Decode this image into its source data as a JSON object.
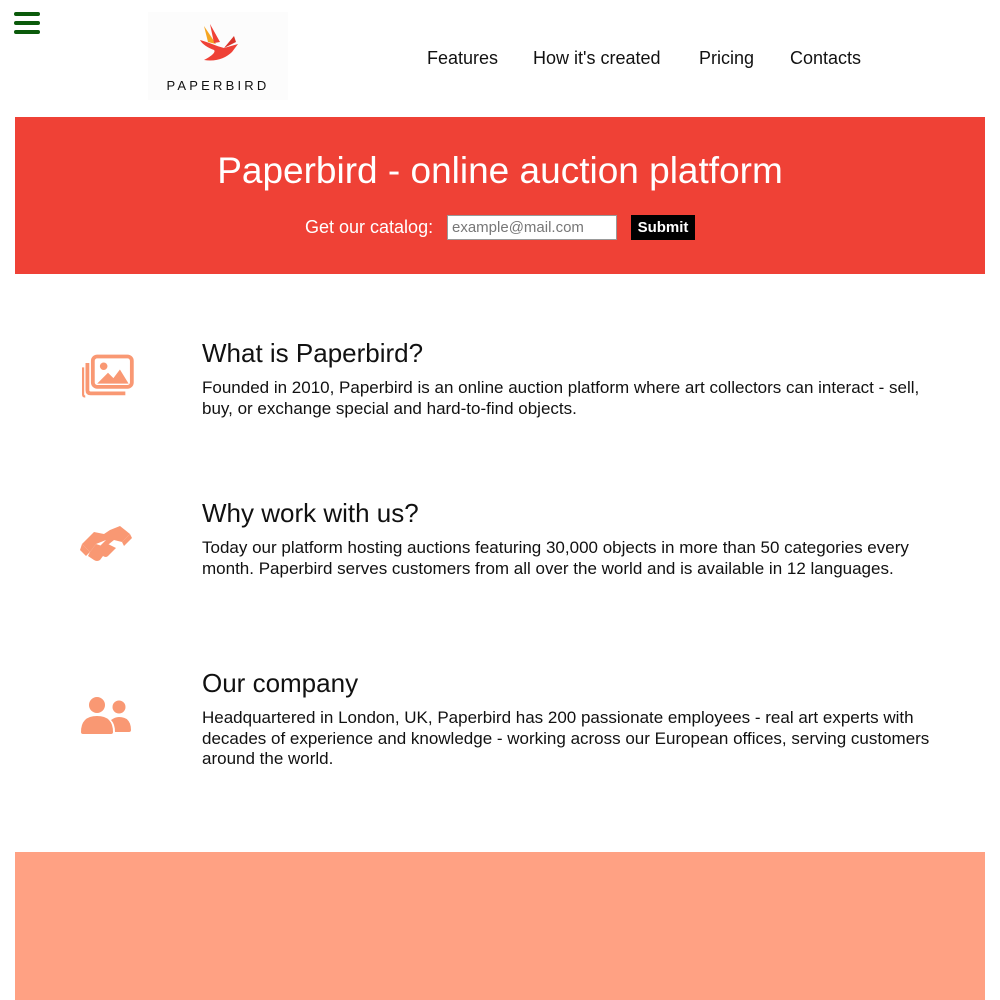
{
  "colors": {
    "accent_red": "#ef4136",
    "accent_salmon": "#ffa183",
    "icon_salmon": "#f99873",
    "menu_green": "#0b5a0b",
    "logo_orange": "#f5a623"
  },
  "header": {
    "menu_icon": "hamburger-menu-icon",
    "logo": {
      "text": "PAPERBIRD",
      "icon": "paperbird-logo-icon"
    },
    "nav": [
      {
        "label": "Features"
      },
      {
        "label": "How it's created"
      },
      {
        "label": "Pricing"
      },
      {
        "label": "Contacts"
      }
    ]
  },
  "hero": {
    "title": "Paperbird - online auction platform",
    "catalog_label": "Get our catalog:",
    "email_placeholder": "example@mail.com",
    "email_value": "",
    "submit_label": "Submit"
  },
  "features": [
    {
      "icon": "image-gallery-icon",
      "title": "What is Paperbird?",
      "text": "Founded in 2010, Paperbird is an online auction platform where art collectors can interact - sell, buy, or exchange special and hard-to-find objects."
    },
    {
      "icon": "handshake-icon",
      "title": "Why work with us?",
      "text": "Today our platform hosting auctions featuring 30,000 objects in more than 50 categories every month. Paperbird serves customers from all over the world and is available in 12 languages."
    },
    {
      "icon": "users-icon",
      "title": "Our company",
      "text": "Headquartered in London, UK, Paperbird has 200 passionate employees - real art experts with decades of experience and knowledge - working across our European offices, serving customers around the world."
    }
  ]
}
